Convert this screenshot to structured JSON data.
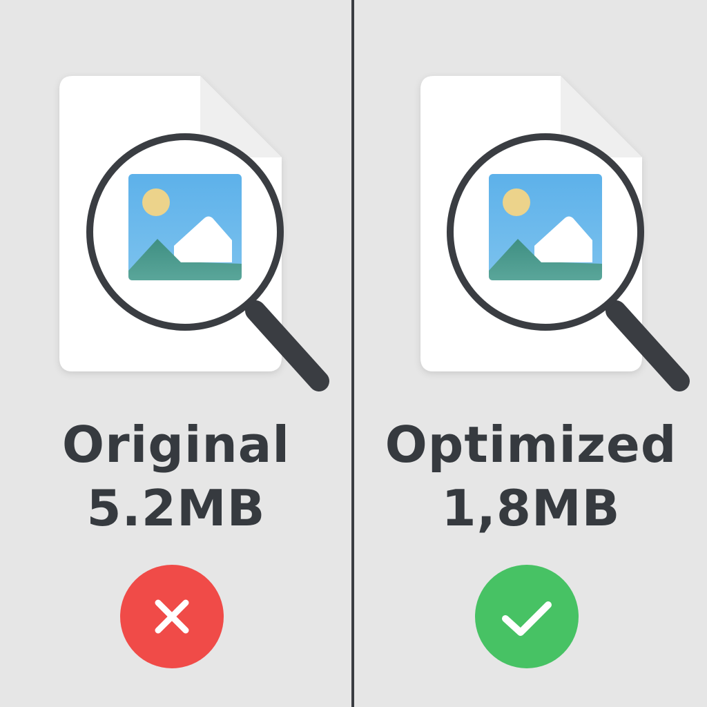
{
  "comparison": {
    "original": {
      "title": "Original",
      "size": "5.2MB",
      "status": "rejected",
      "status_icon": "cross-icon",
      "status_color": "#f04b48"
    },
    "optimized": {
      "title": "Optimized",
      "size": "1,8MB",
      "status": "approved",
      "status_icon": "checkmark-icon",
      "status_color": "#47c264"
    }
  },
  "colors": {
    "background": "#e6e6e6",
    "divider": "#3a3d42",
    "text": "#363a3f",
    "document": "#ffffff",
    "magnifier_frame": "#3a3d42",
    "image_sky": "#6cb9ea",
    "image_sun": "#ecd38b",
    "image_hill": "#4e9b8f"
  }
}
